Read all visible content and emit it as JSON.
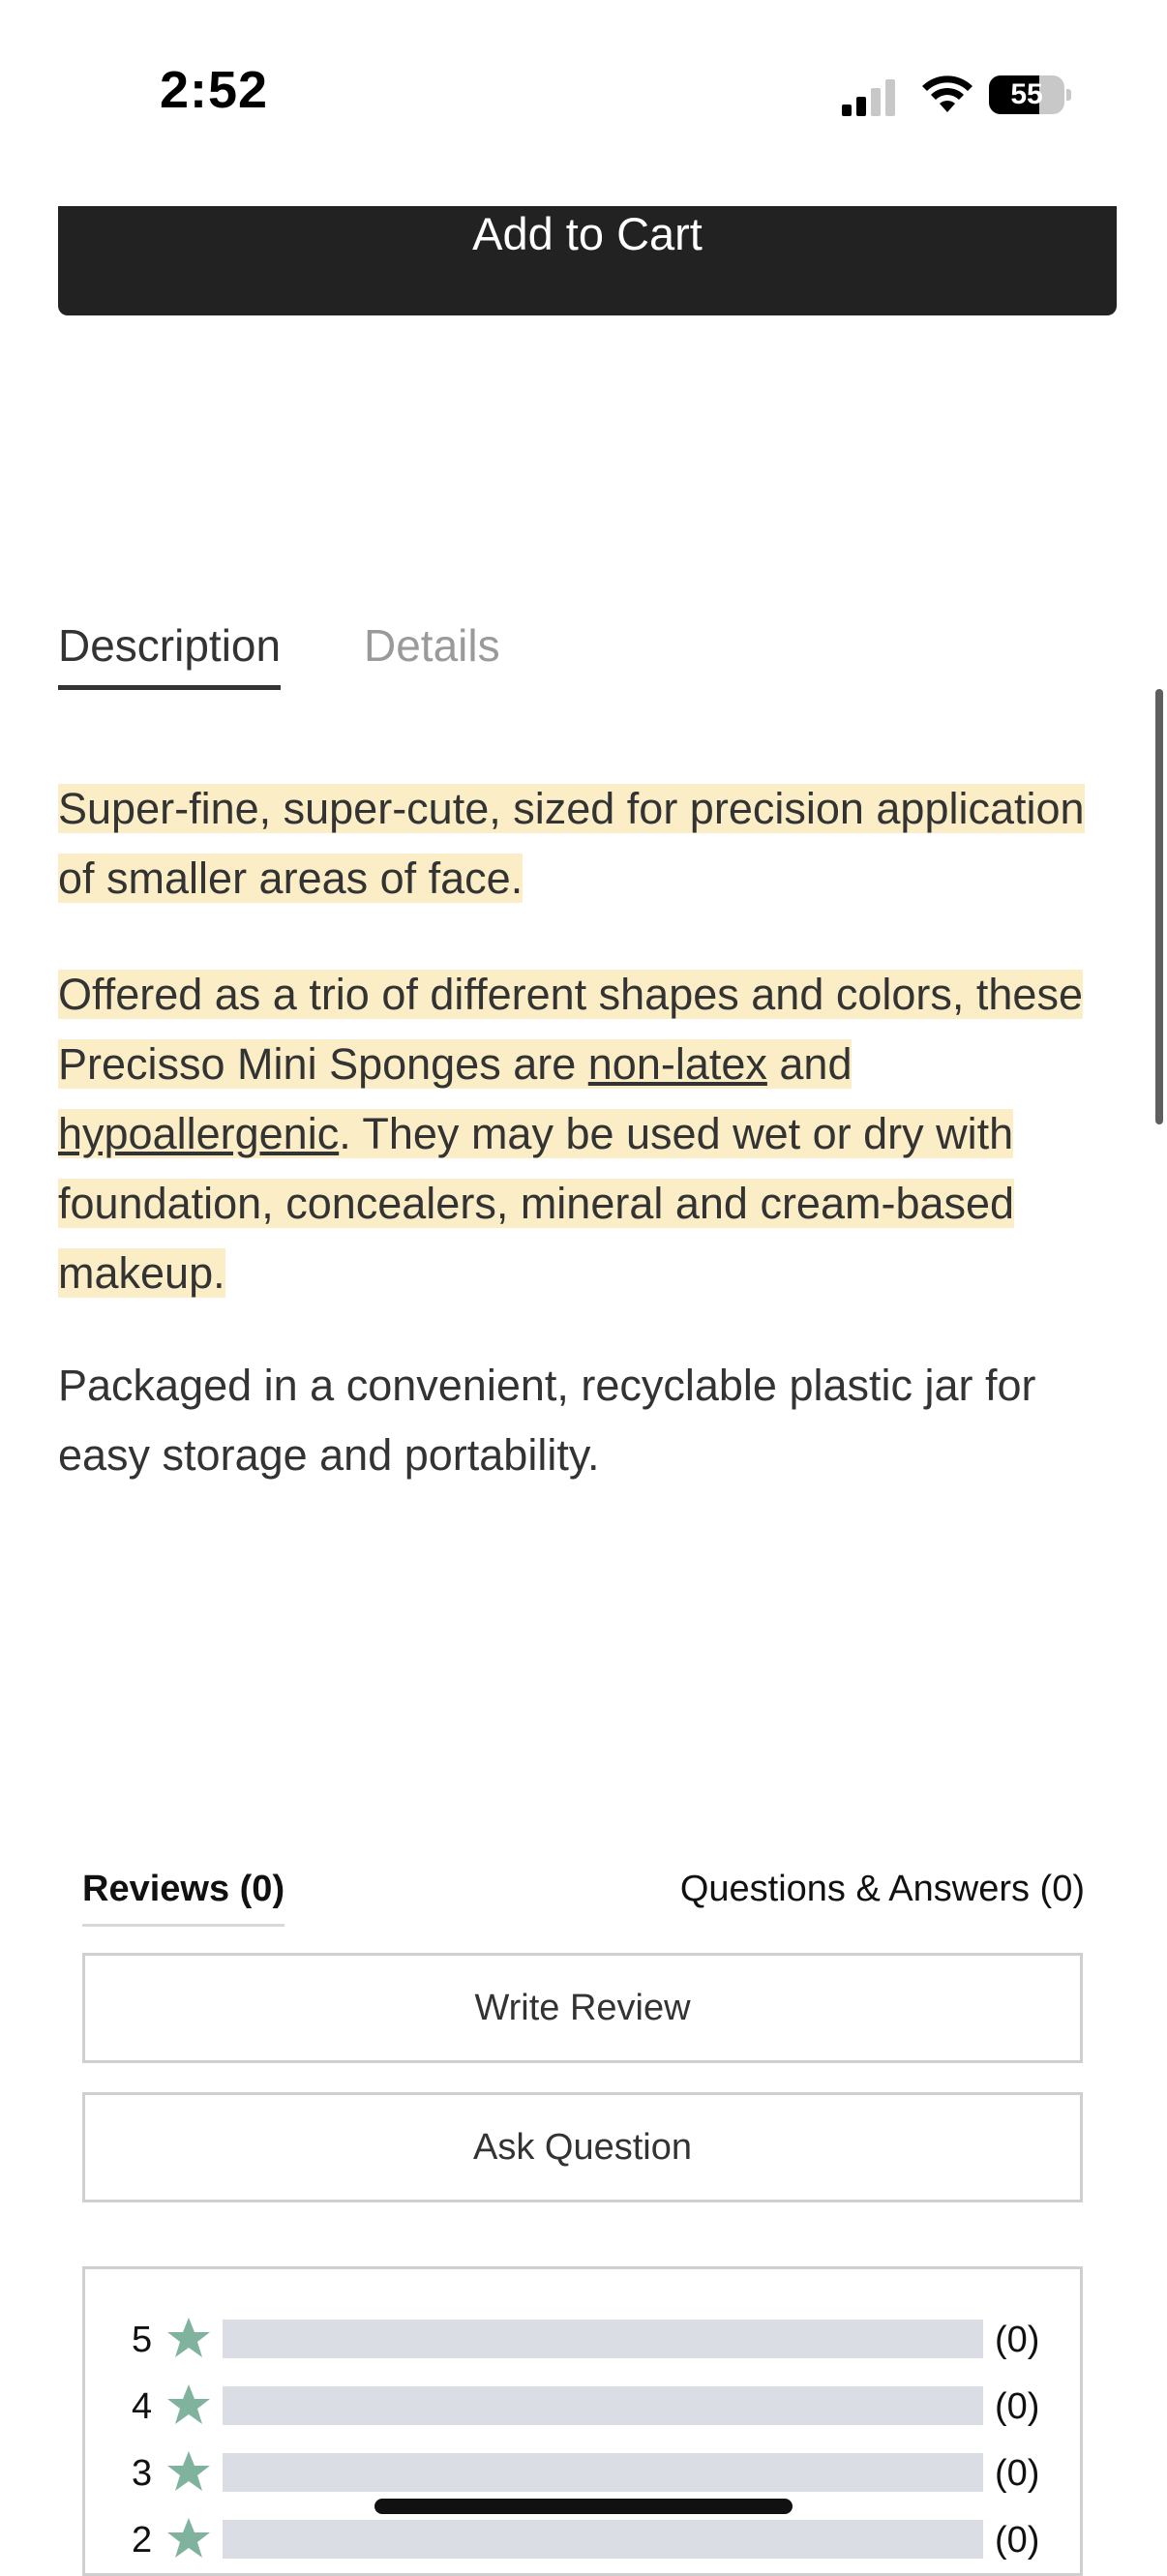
{
  "status_bar": {
    "time": "2:52",
    "battery": "55"
  },
  "product": {
    "add_to_cart_label": "Add to Cart"
  },
  "tabs": [
    {
      "label": "Description",
      "active": true
    },
    {
      "label": "Details",
      "active": false
    }
  ],
  "description": {
    "p1": "Super-fine, super-cute, sized for precision application of smaller areas of face.",
    "p2_a": "Offered as a trio of different shapes and colors, these Precisso Mini Sponges are ",
    "p2_link1": "non-latex",
    "p2_b": " and ",
    "p2_link2": "hypoallergenic",
    "p2_c": ". They may be used wet or dry with foundation, concealers, mineral and cream-based makeup.",
    "p3": "Packaged in a convenient, recyclable plastic jar for easy storage and portability."
  },
  "reviews": {
    "tab_reviews": "Reviews (0)",
    "tab_qa": "Questions & Answers (0)",
    "write_review_label": "Write Review",
    "ask_question_label": "Ask Question",
    "rating_rows": [
      {
        "stars": "5",
        "count": "(0)",
        "fraction": 0
      },
      {
        "stars": "4",
        "count": "(0)",
        "fraction": 0
      },
      {
        "stars": "3",
        "count": "(0)",
        "fraction": 0
      },
      {
        "stars": "2",
        "count": "(0)",
        "fraction": 0
      }
    ]
  },
  "colors": {
    "highlight": "#fbeec6",
    "star": "#7fb39e",
    "bar_track": "#dadde3",
    "button_dark": "#222222"
  }
}
